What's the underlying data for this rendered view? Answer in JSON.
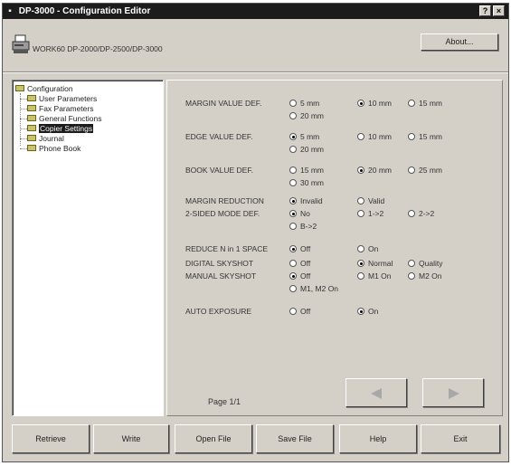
{
  "window": {
    "title": "DP-3000 - Configuration Editor",
    "help_button": "?",
    "close_button": "×"
  },
  "header": {
    "model_text": "WORK60 DP-2000/DP-2500/DP-3000",
    "about_label": "About..."
  },
  "tree": {
    "root": "Configuration",
    "items": [
      {
        "label": "User Parameters",
        "selected": false
      },
      {
        "label": "Fax Parameters",
        "selected": false
      },
      {
        "label": "General Functions",
        "selected": false
      },
      {
        "label": "Copier Settings",
        "selected": true
      },
      {
        "label": "Journal",
        "selected": false
      },
      {
        "label": "Phone Book",
        "selected": false
      }
    ]
  },
  "settings": [
    {
      "label": "MARGIN VALUE DEF.",
      "options": [
        {
          "text": "5 mm",
          "checked": false
        },
        {
          "text": "10 mm",
          "checked": true
        },
        {
          "text": "15 mm",
          "checked": false
        },
        {
          "text": "20 mm",
          "checked": false
        }
      ]
    },
    {
      "label": "EDGE VALUE DEF.",
      "options": [
        {
          "text": "5 mm",
          "checked": true
        },
        {
          "text": "10 mm",
          "checked": false
        },
        {
          "text": "15 mm",
          "checked": false
        },
        {
          "text": "20 mm",
          "checked": false
        }
      ]
    },
    {
      "label": "BOOK VALUE DEF.",
      "options": [
        {
          "text": "15 mm",
          "checked": false
        },
        {
          "text": "20 mm",
          "checked": true
        },
        {
          "text": "25 mm",
          "checked": false
        },
        {
          "text": "30 mm",
          "checked": false
        }
      ]
    },
    {
      "label": "MARGIN REDUCTION",
      "options": [
        {
          "text": "Invalid",
          "checked": true
        },
        {
          "text": "Valid",
          "checked": false
        }
      ]
    },
    {
      "label": "2-SIDED MODE DEF.",
      "options": [
        {
          "text": "No",
          "checked": true
        },
        {
          "text": "1->2",
          "checked": false
        },
        {
          "text": "2->2",
          "checked": false
        },
        {
          "text": "B->2",
          "checked": false
        }
      ]
    },
    {
      "label": "REDUCE N in 1 SPACE",
      "options": [
        {
          "text": "Off",
          "checked": true
        },
        {
          "text": "On",
          "checked": false
        }
      ]
    },
    {
      "label": "DIGITAL SKYSHOT",
      "options": [
        {
          "text": "Off",
          "checked": false
        },
        {
          "text": "Normal",
          "checked": true
        },
        {
          "text": "Quality",
          "checked": false
        }
      ]
    },
    {
      "label": "MANUAL SKYSHOT",
      "options": [
        {
          "text": "Off",
          "checked": true
        },
        {
          "text": "M1 On",
          "checked": false
        },
        {
          "text": "M2 On",
          "checked": false
        },
        {
          "text": "M1, M2 On",
          "checked": false
        }
      ]
    },
    {
      "label": "AUTO EXPOSURE",
      "options": [
        {
          "text": "Off",
          "checked": false
        },
        {
          "text": "On",
          "checked": true
        }
      ]
    }
  ],
  "pager": {
    "page_label": "Page 1/1",
    "prev_icon": "left-triangle",
    "next_icon": "right-triangle"
  },
  "bottom_buttons": {
    "retrieve": "Retrieve",
    "write": "Write",
    "open_file": "Open File",
    "save_file": "Save File",
    "help": "Help",
    "exit": "Exit"
  }
}
